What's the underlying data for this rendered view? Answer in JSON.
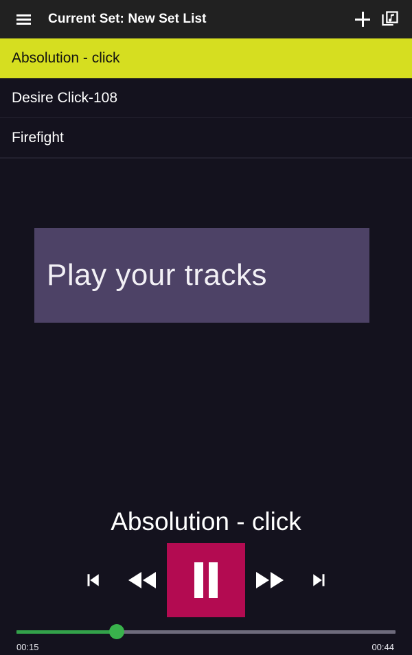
{
  "appbar": {
    "menu_icon": "hamburger-menu-icon",
    "title": "Current Set: New Set List",
    "add_icon": "plus-icon",
    "library_icon": "library-music-icon"
  },
  "tracklist": {
    "rows": [
      {
        "title": "Absolution - click",
        "selected": true
      },
      {
        "title": "Desire Click-108",
        "selected": false
      },
      {
        "title": "Firefight",
        "selected": false
      }
    ]
  },
  "stage": {
    "play_panel_label": "Play your tracks"
  },
  "player": {
    "now_playing": "Absolution - click",
    "controls": {
      "skip_previous": "skip-previous-icon",
      "rewind": "rewind-icon",
      "pause": "pause-icon",
      "fast_forward": "fast-forward-icon",
      "skip_next": "skip-next-icon"
    },
    "seek": {
      "elapsed": "00:15",
      "duration": "00:44",
      "progress_percent": 26.5
    }
  },
  "colors": {
    "background": "#14121e",
    "appbar": "#212121",
    "selected_row": "#d6de20",
    "play_panel": "#4d4266",
    "pause_button": "#b30b51",
    "seek_fill": "#33a14a",
    "seek_thumb": "#39b24c",
    "seek_background": "#6e6b7c"
  }
}
